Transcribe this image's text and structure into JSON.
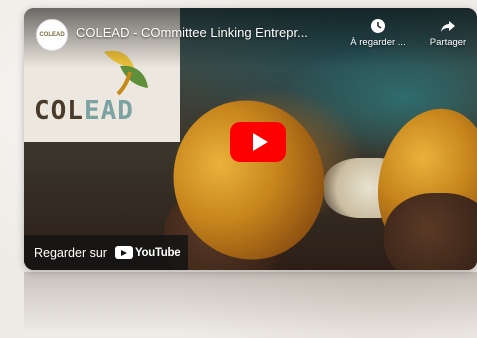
{
  "video": {
    "title": "COLEAD - COmmittee Linking Entrepr...",
    "channel_avatar_text": "COLEAD"
  },
  "logo": {
    "word_part1": "COL",
    "word_part2": "EAD",
    "accent_color": "#7da2a2"
  },
  "actions": {
    "watch_later_label": "À regarder ...",
    "watch_later_icon": "clock-icon",
    "share_label": "Partager",
    "share_icon": "share-arrow-icon"
  },
  "watch_on": {
    "label": "Regarder sur",
    "brand": "YouTube"
  },
  "colors": {
    "play_button": "#ff0000"
  }
}
